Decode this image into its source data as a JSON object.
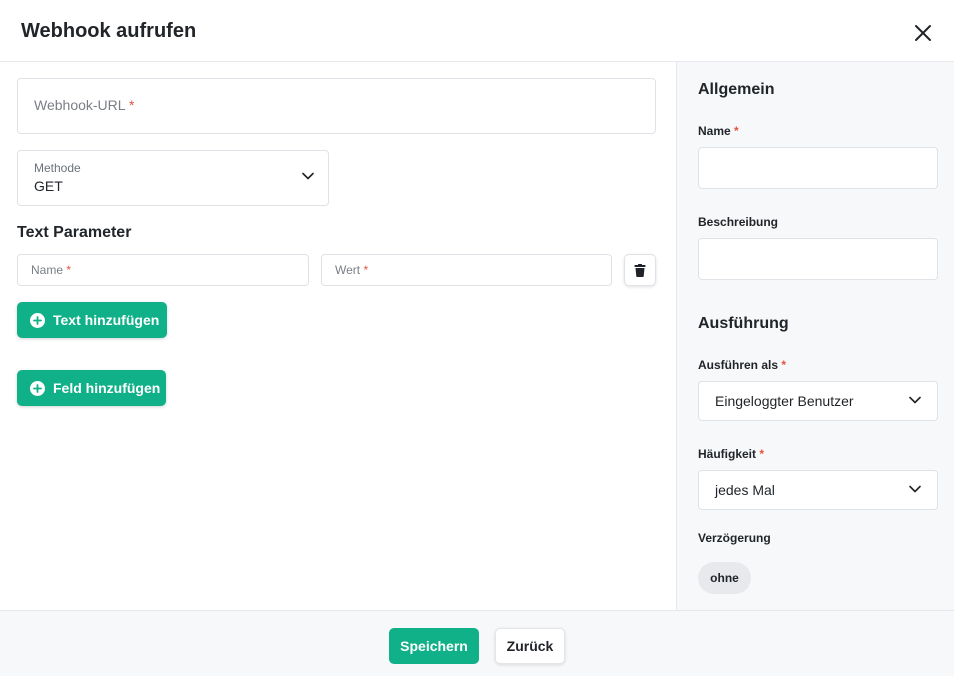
{
  "dialog": {
    "title": "Webhook aufrufen"
  },
  "main": {
    "url_field": {
      "label": "Webhook-URL",
      "required_mark": "*"
    },
    "method_field": {
      "label": "Methode",
      "value": "GET"
    },
    "text_parameter": {
      "title": "Text Parameter",
      "name_placeholder": "Name",
      "value_placeholder": "Wert",
      "required_mark": "*"
    },
    "add_text_label": "Text hinzufügen",
    "add_field_label": "Feld hinzufügen"
  },
  "sidebar": {
    "general_heading": "Allgemein",
    "name_label": "Name",
    "description_label": "Beschreibung",
    "execution_heading": "Ausführung",
    "run_as_label": "Ausführen als",
    "run_as_value": "Eingeloggter Benutzer",
    "frequency_label": "Häufigkeit",
    "frequency_value": "jedes Mal",
    "delay_label": "Verzögerung",
    "delay_value": "ohne",
    "required_mark": "*"
  },
  "footer": {
    "save_label": "Speichern",
    "back_label": "Zurück"
  },
  "colors": {
    "primary": "#10b088",
    "required": "#e5533d",
    "sidebar_bg": "#f7f8fa"
  },
  "icons": {
    "close": "close-icon",
    "chevron": "chevron-down-icon",
    "trash": "trash-icon",
    "plus": "plus-circle-icon"
  }
}
